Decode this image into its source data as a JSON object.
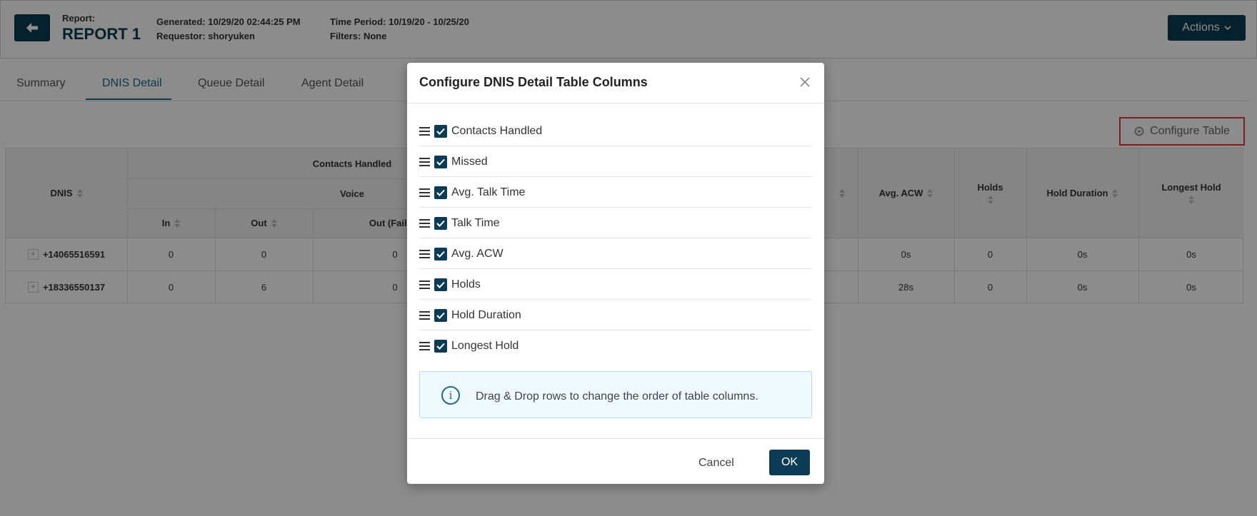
{
  "header": {
    "report_label": "Report:",
    "report_name": "REPORT 1",
    "generated": "Generated: 10/29/20 02:44:25 PM",
    "requestor": "Requestor: shoryuken",
    "time_period": "Time Period: 10/19/20 - 10/25/20",
    "filters": "Filters: None",
    "actions_label": "Actions"
  },
  "tabs": [
    {
      "label": "Summary"
    },
    {
      "label": "DNIS Detail"
    },
    {
      "label": "Queue Detail"
    },
    {
      "label": "Agent Detail"
    }
  ],
  "configure_table_label": "Configure Table",
  "table": {
    "headers": {
      "dnis": "DNIS",
      "contacts_handled": "Contacts Handled",
      "voice": "Voice",
      "in": "In",
      "out": "Out",
      "out_failed": "Out (Failed)",
      "avg_acw": "Avg. ACW",
      "holds": "Holds",
      "hold_duration": "Hold Duration",
      "longest_hold": "Longest Hold"
    },
    "rows": [
      {
        "dnis": "+14065516591",
        "in": "0",
        "out": "0",
        "out_failed": "0",
        "avg_acw": "0s",
        "holds": "0",
        "hold_duration": "0s",
        "longest_hold": "0s"
      },
      {
        "dnis": "+18336550137",
        "in": "0",
        "out": "6",
        "out_failed": "0",
        "avg_acw": "28s",
        "holds": "0",
        "hold_duration": "0s",
        "longest_hold": "0s"
      }
    ]
  },
  "modal": {
    "title": "Configure DNIS Detail Table Columns",
    "columns": [
      {
        "label": "Contacts Handled",
        "checked": true
      },
      {
        "label": "Missed",
        "checked": true
      },
      {
        "label": "Avg. Talk Time",
        "checked": true
      },
      {
        "label": "Talk Time",
        "checked": true
      },
      {
        "label": "Avg. ACW",
        "checked": true
      },
      {
        "label": "Holds",
        "checked": true
      },
      {
        "label": "Hold Duration",
        "checked": true
      },
      {
        "label": "Longest Hold",
        "checked": true
      }
    ],
    "info_text": "Drag & Drop rows to change the order of table columns.",
    "cancel_label": "Cancel",
    "ok_label": "OK"
  },
  "colors": {
    "primary": "#0c3c55",
    "accent": "#1d6a8a",
    "highlight": "#e53935"
  },
  "icons": {
    "back": "arrow-left-icon",
    "actions": "chevron-down-icon",
    "configure": "gear-icon",
    "close": "close-icon",
    "drag": "drag-handle-icon",
    "check": "checkmark-icon",
    "info": "info-icon",
    "expand": "plus-icon",
    "sort": "sort-icon"
  }
}
